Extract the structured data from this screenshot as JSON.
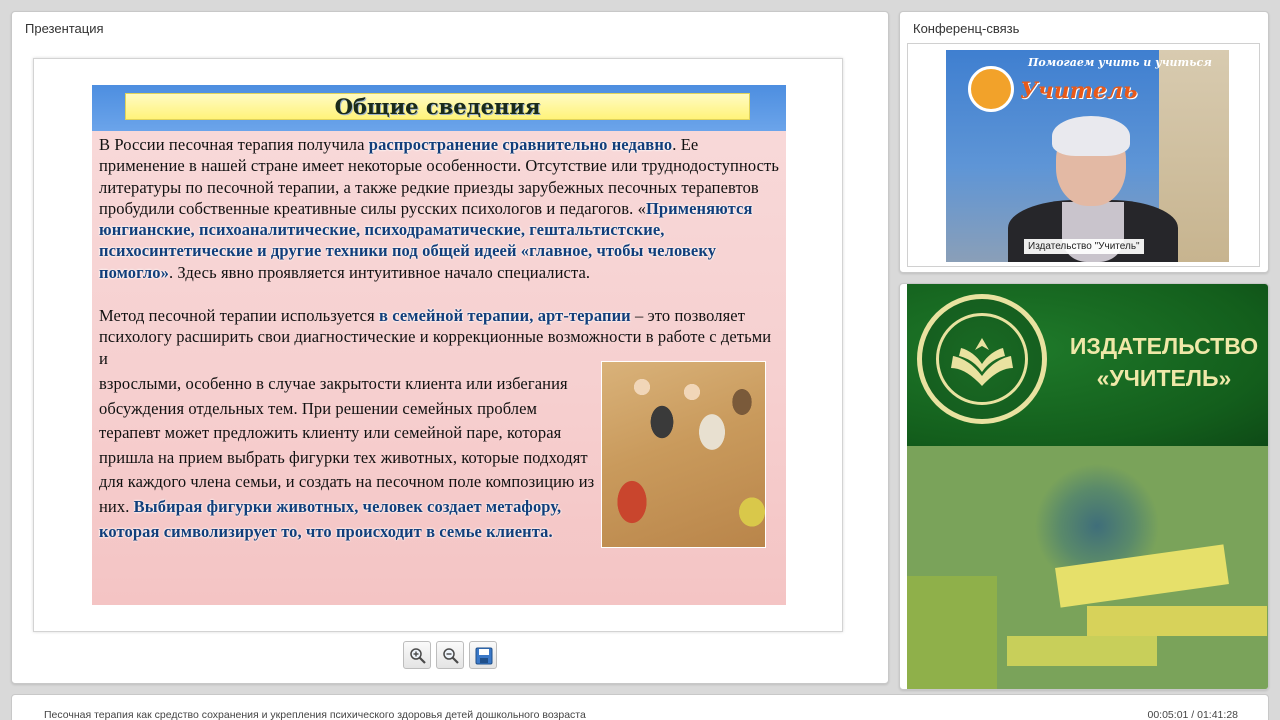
{
  "presentation": {
    "title": "Презентация",
    "slide": {
      "heading": "Общие сведения",
      "para1": [
        {
          "text": "В России песочная терапия получила ",
          "highlight": false
        },
        {
          "text": "распространение сравнительно недавно",
          "highlight": true
        },
        {
          "text": ". Ее применение в нашей стране имеет некоторые особенности. Отсутствие или труднодоступность литературы по песочной терапии, а также редкие приезды зарубежных песочных терапевтов пробудили собственные креативные силы русских психологов и педагогов. «",
          "highlight": false
        },
        {
          "text": "Применяются юнгианские, психоаналитические, психодраматические, гештальтистские, психосинтетические и другие техники под общей идеей «главное, чтобы человеку помогло»",
          "highlight": true
        },
        {
          "text": ". Здесь явно проявляется интуитивное начало специалиста.",
          "highlight": false
        }
      ],
      "para2": [
        {
          "text": "Метод песочной терапии используется ",
          "highlight": false
        },
        {
          "text": "в семейной терапии, арт-терапии",
          "highlight": true
        },
        {
          "text": " – это позволяет психологу расширить свои диагностические и коррекционные возможности в работе с детьми и",
          "highlight": false
        }
      ],
      "para3": [
        {
          "text": "взрослыми, особенно в случае закрытости клиента или избегания обсуждения отдельных тем. При решении семейных проблем терапевт может предложить клиенту или семейной паре, которая пришла на прием выбрать фигурки тех животных, которые подходят для каждого члена семьи, и создать на песочном поле композицию из них. ",
          "highlight": false
        },
        {
          "text": "Выбирая фигурки животных, человек создает метафору, которая символизирует то, что происходит в семье клиента.",
          "highlight": true
        }
      ]
    },
    "toolbar": {
      "zoom_in_icon": "zoom-in-icon",
      "zoom_out_icon": "zoom-out-icon",
      "save_icon": "save-icon"
    }
  },
  "conference": {
    "title": "Конференц-связь",
    "banner_top": "Помогаем учить и учиться",
    "banner_word": "Учитель",
    "caption": "Издательство \"Учитель\""
  },
  "promo": {
    "name": "ИЗДАТЕЛЬСТВО «УЧИТЕЛЬ»"
  },
  "status": {
    "lecture_title": "Песочная терапия как средство сохранения и укрепления психического здоровья детей дошкольного возраста",
    "time": "00:05:01 / 01:41:28"
  },
  "colors": {
    "highlight_text": "#123e7a",
    "slide_header": "#4d8ee0",
    "title_box": "#fff37a",
    "promo_green": "#135e1c"
  }
}
